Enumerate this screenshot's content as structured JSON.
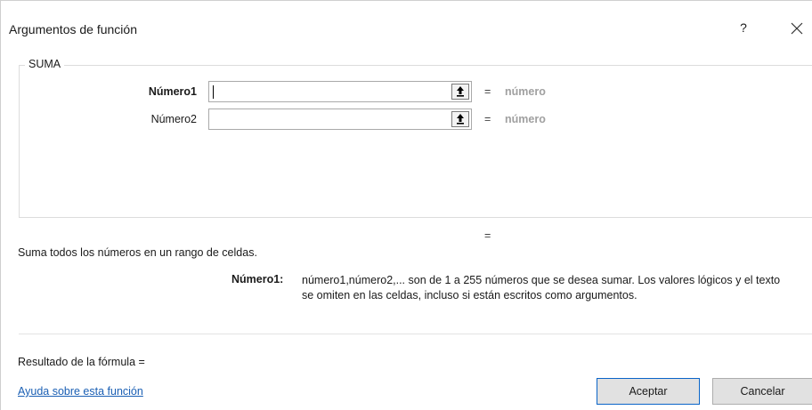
{
  "window": {
    "title": "Argumentos de función",
    "help_label": "?",
    "close_icon": "close-icon"
  },
  "function_group": {
    "name": "SUMA",
    "args": [
      {
        "label": "Número1",
        "value": "",
        "equals": "=",
        "result": "número",
        "bold": true
      },
      {
        "label": "Número2",
        "value": "",
        "equals": "=",
        "result": "número",
        "bold": false
      }
    ],
    "collapse_icon": "collapse-dialog-arrow-icon"
  },
  "result_equals": "=",
  "description": "Suma todos los números en un rango de celdas.",
  "param_help": {
    "name": "Número1:",
    "text_line1": "número1,número2,... son de 1 a 255 números que se desea sumar. Los valores lógicos y el texto",
    "text_line2": "se omiten en las celdas, incluso si están escritos como argumentos."
  },
  "formula_result_label": "Resultado de la fórmula =",
  "help_link": "Ayuda sobre esta función",
  "buttons": {
    "ok": "Aceptar",
    "cancel": "Cancelar"
  },
  "colors": {
    "accent_border": "#0a64c8",
    "link": "#1a5fb4",
    "placeholder": "#a0a0a0"
  }
}
